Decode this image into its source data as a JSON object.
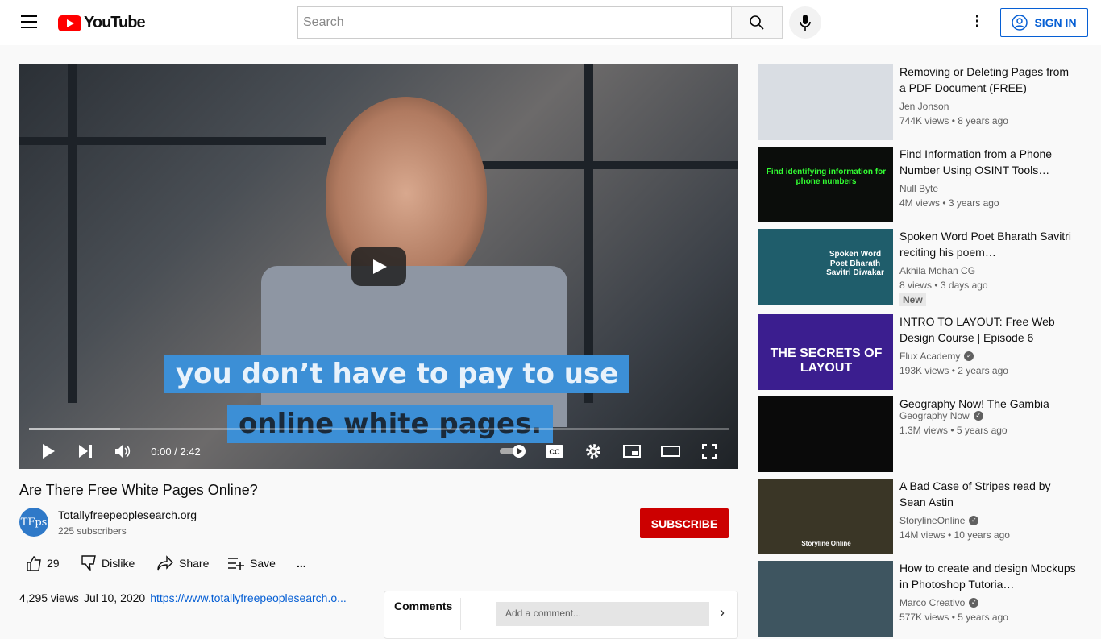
{
  "header": {
    "logo": "YouTube",
    "search_placeholder": "Search",
    "sign_in": "SIGN IN"
  },
  "player": {
    "caption_line1": "you don’t have to pay to use",
    "caption_line2": "online white pages.",
    "time": "0:00 / 2:42",
    "progress_buffered_fraction": 0.13
  },
  "video": {
    "title": "Are There Free White Pages Online?",
    "channel": "Totallyfreepeoplesearch.org",
    "avatar_text": "TFps",
    "subscribers": "225 subscribers",
    "subscribe": "SUBSCRIBE",
    "likes": "29",
    "dislike": "Dislike",
    "share": "Share",
    "save": "Save",
    "more": "...",
    "views": "4,295 views",
    "date": "Jul 10, 2020",
    "link": "https://www.totallyfreepeoplesearch.o..."
  },
  "comments": {
    "label": "Comments",
    "placeholder": "Add a comment..."
  },
  "related": [
    {
      "title": "Removing or Deleting Pages from a PDF Document (FREE)",
      "channel": "Jen Jonson",
      "verified": false,
      "meta": "744K views • 8 years ago",
      "thumb_color": "#d9dde3"
    },
    {
      "title": "Find Information from a Phone Number Using OSINT Tools…",
      "channel": "Null Byte",
      "verified": false,
      "meta": "4M views • 3 years ago",
      "thumb_color": "#0b0d0b",
      "thumb_text": "Find identifying information for phone numbers"
    },
    {
      "title": "Spoken Word Poet Bharath Savitri reciting his poem…",
      "channel": "Akhila Mohan CG",
      "verified": false,
      "meta": "8 views • 3 days ago",
      "badge": "New",
      "thumb_color": "#1f5d6b",
      "thumb_text": "Spoken Word Poet Bharath Savitri Diwakar"
    },
    {
      "title": "INTRO TO LAYOUT: Free Web Design Course | Episode 6",
      "channel": "Flux Academy",
      "verified": true,
      "meta": "193K views • 2 years ago",
      "thumb_color": "#3b1e8f",
      "thumb_text": "THE SECRETS OF LAYOUT"
    },
    {
      "title": "Geography Now! The Gambia",
      "channel": "Geography Now",
      "verified": true,
      "meta": "1.3M views • 5 years ago",
      "thumb_color": "#0a0a0a"
    },
    {
      "title": "A Bad Case of Stripes read by Sean Astin",
      "channel": "StorylineOnline",
      "verified": true,
      "meta": "14M views • 10 years ago",
      "thumb_color": "#3a3626",
      "thumb_text": "Storyline Online"
    },
    {
      "title": "How to create and design Mockups in Photoshop Tutoria…",
      "channel": "Marco Creativo",
      "verified": true,
      "meta": "577K views • 5 years ago",
      "thumb_color": "#3e5560"
    }
  ]
}
